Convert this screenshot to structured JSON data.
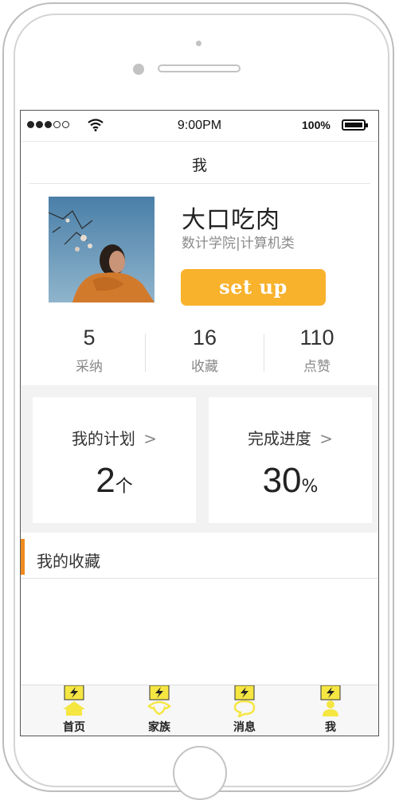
{
  "status_bar": {
    "time": "9:00PM",
    "battery_percent": "100%",
    "signal_bars_filled": 3,
    "signal_bars_total": 5
  },
  "nav": {
    "title": "我"
  },
  "profile": {
    "name": "大口吃肉",
    "department": "数计学院|计算机类",
    "setup_button": "set up"
  },
  "stats": [
    {
      "value": "5",
      "label": "采纳"
    },
    {
      "value": "16",
      "label": "收藏"
    },
    {
      "value": "110",
      "label": "点赞"
    }
  ],
  "cards": [
    {
      "title": "我的计划",
      "chevron": ">",
      "value": "2",
      "unit": "个"
    },
    {
      "title": "完成进度",
      "chevron": ">",
      "value": "30",
      "unit": "%"
    }
  ],
  "favorites": {
    "title": "我的收藏"
  },
  "tabbar": {
    "items": [
      {
        "label": "首页",
        "icon": "home-icon"
      },
      {
        "label": "家族",
        "icon": "family-icon"
      },
      {
        "label": "消息",
        "icon": "message-icon"
      },
      {
        "label": "我",
        "icon": "me-icon"
      }
    ]
  },
  "colors": {
    "accent": "#f8b22c",
    "favorites_bar": "#f08a1e",
    "tab_icon": "#f5e642",
    "card_background": "#f2f2f2"
  }
}
